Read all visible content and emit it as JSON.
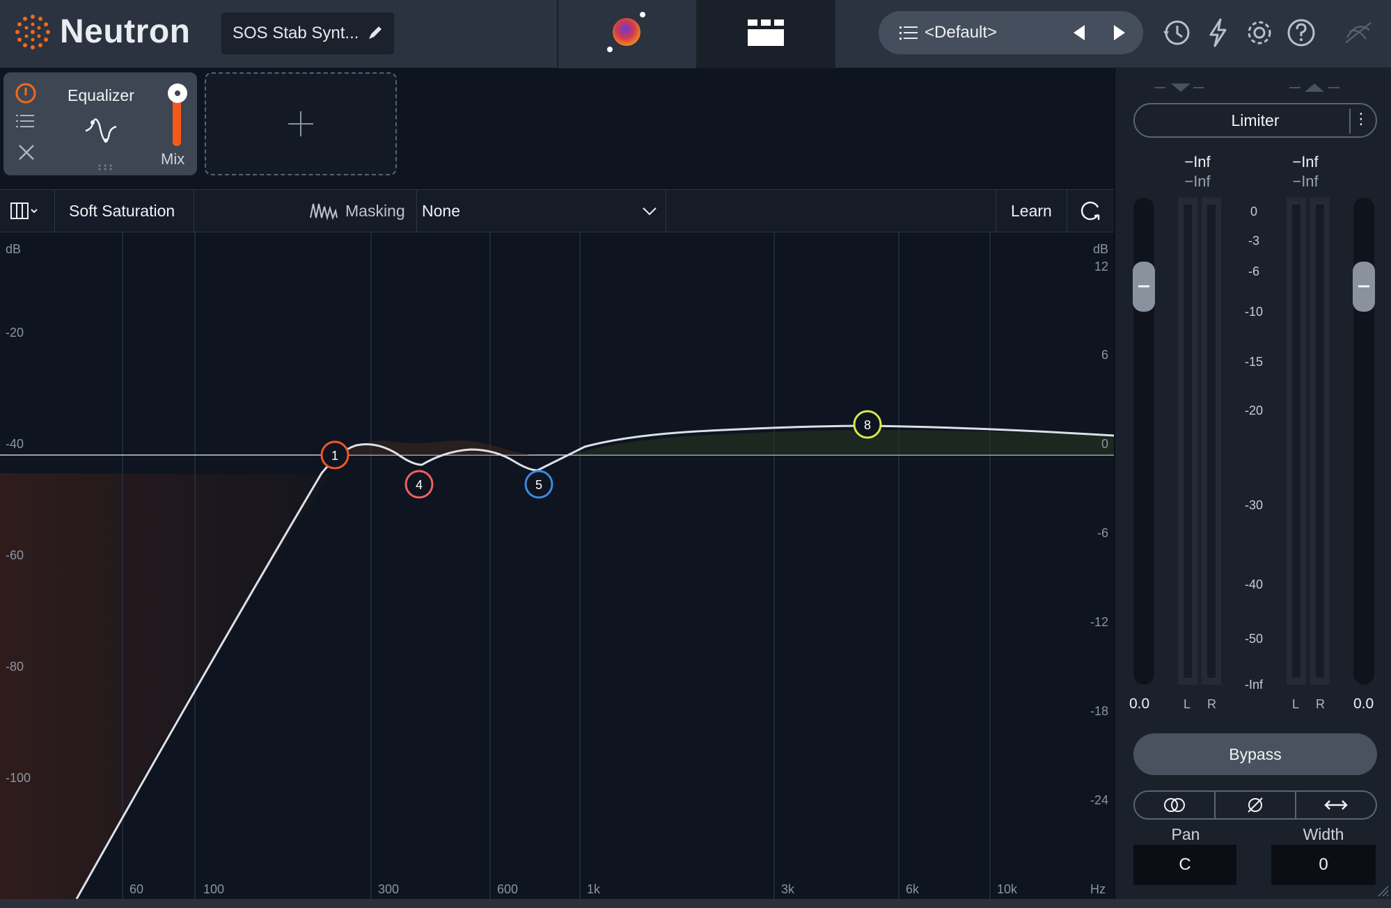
{
  "app": {
    "title": "Neutron"
  },
  "header": {
    "preset_name": "SOS Stab Synt...",
    "preset_nav_label": "<Default>"
  },
  "module": {
    "name": "Equalizer",
    "mix_label": "Mix",
    "mix_value": 1.0
  },
  "toolbar": {
    "mode_label": "Soft Saturation",
    "masking_label": "Masking",
    "masking_value": "None",
    "learn_label": "Learn"
  },
  "eq": {
    "left_axis_unit": "dB",
    "right_axis_unit": "dB",
    "left_ticks": [
      "-20",
      "-40",
      "-60",
      "-80",
      "-100"
    ],
    "right_ticks": [
      "12",
      "6",
      "0",
      "-6",
      "-12",
      "-18",
      "-24"
    ],
    "freq_ticks": [
      "60",
      "100",
      "300",
      "600",
      "1k",
      "3k",
      "6k",
      "10k",
      "Hz"
    ],
    "nodes": [
      {
        "label": "1",
        "color": "#f2562a"
      },
      {
        "label": "4",
        "color": "#f06060"
      },
      {
        "label": "5",
        "color": "#3a8be0"
      },
      {
        "label": "8",
        "color": "#d7e84a"
      }
    ]
  },
  "limiter": {
    "title": "Limiter",
    "in_peak": "−Inf",
    "in_rms": "−Inf",
    "out_peak": "−Inf",
    "out_rms": "−Inf",
    "scale": [
      "0",
      "-3",
      "-6",
      "-10",
      "-15",
      "-20",
      "-30",
      "-40",
      "-50",
      "-Inf"
    ],
    "in_gain": "0.0",
    "out_gain": "0.0",
    "l_label": "L",
    "r_label": "R",
    "bypass_label": "Bypass",
    "pan_label": "Pan",
    "pan_value": "C",
    "width_label": "Width",
    "width_value": "0"
  },
  "colors": {
    "accent": "#f35a1a",
    "background": "#0e1420",
    "panel": "#1b212b"
  }
}
